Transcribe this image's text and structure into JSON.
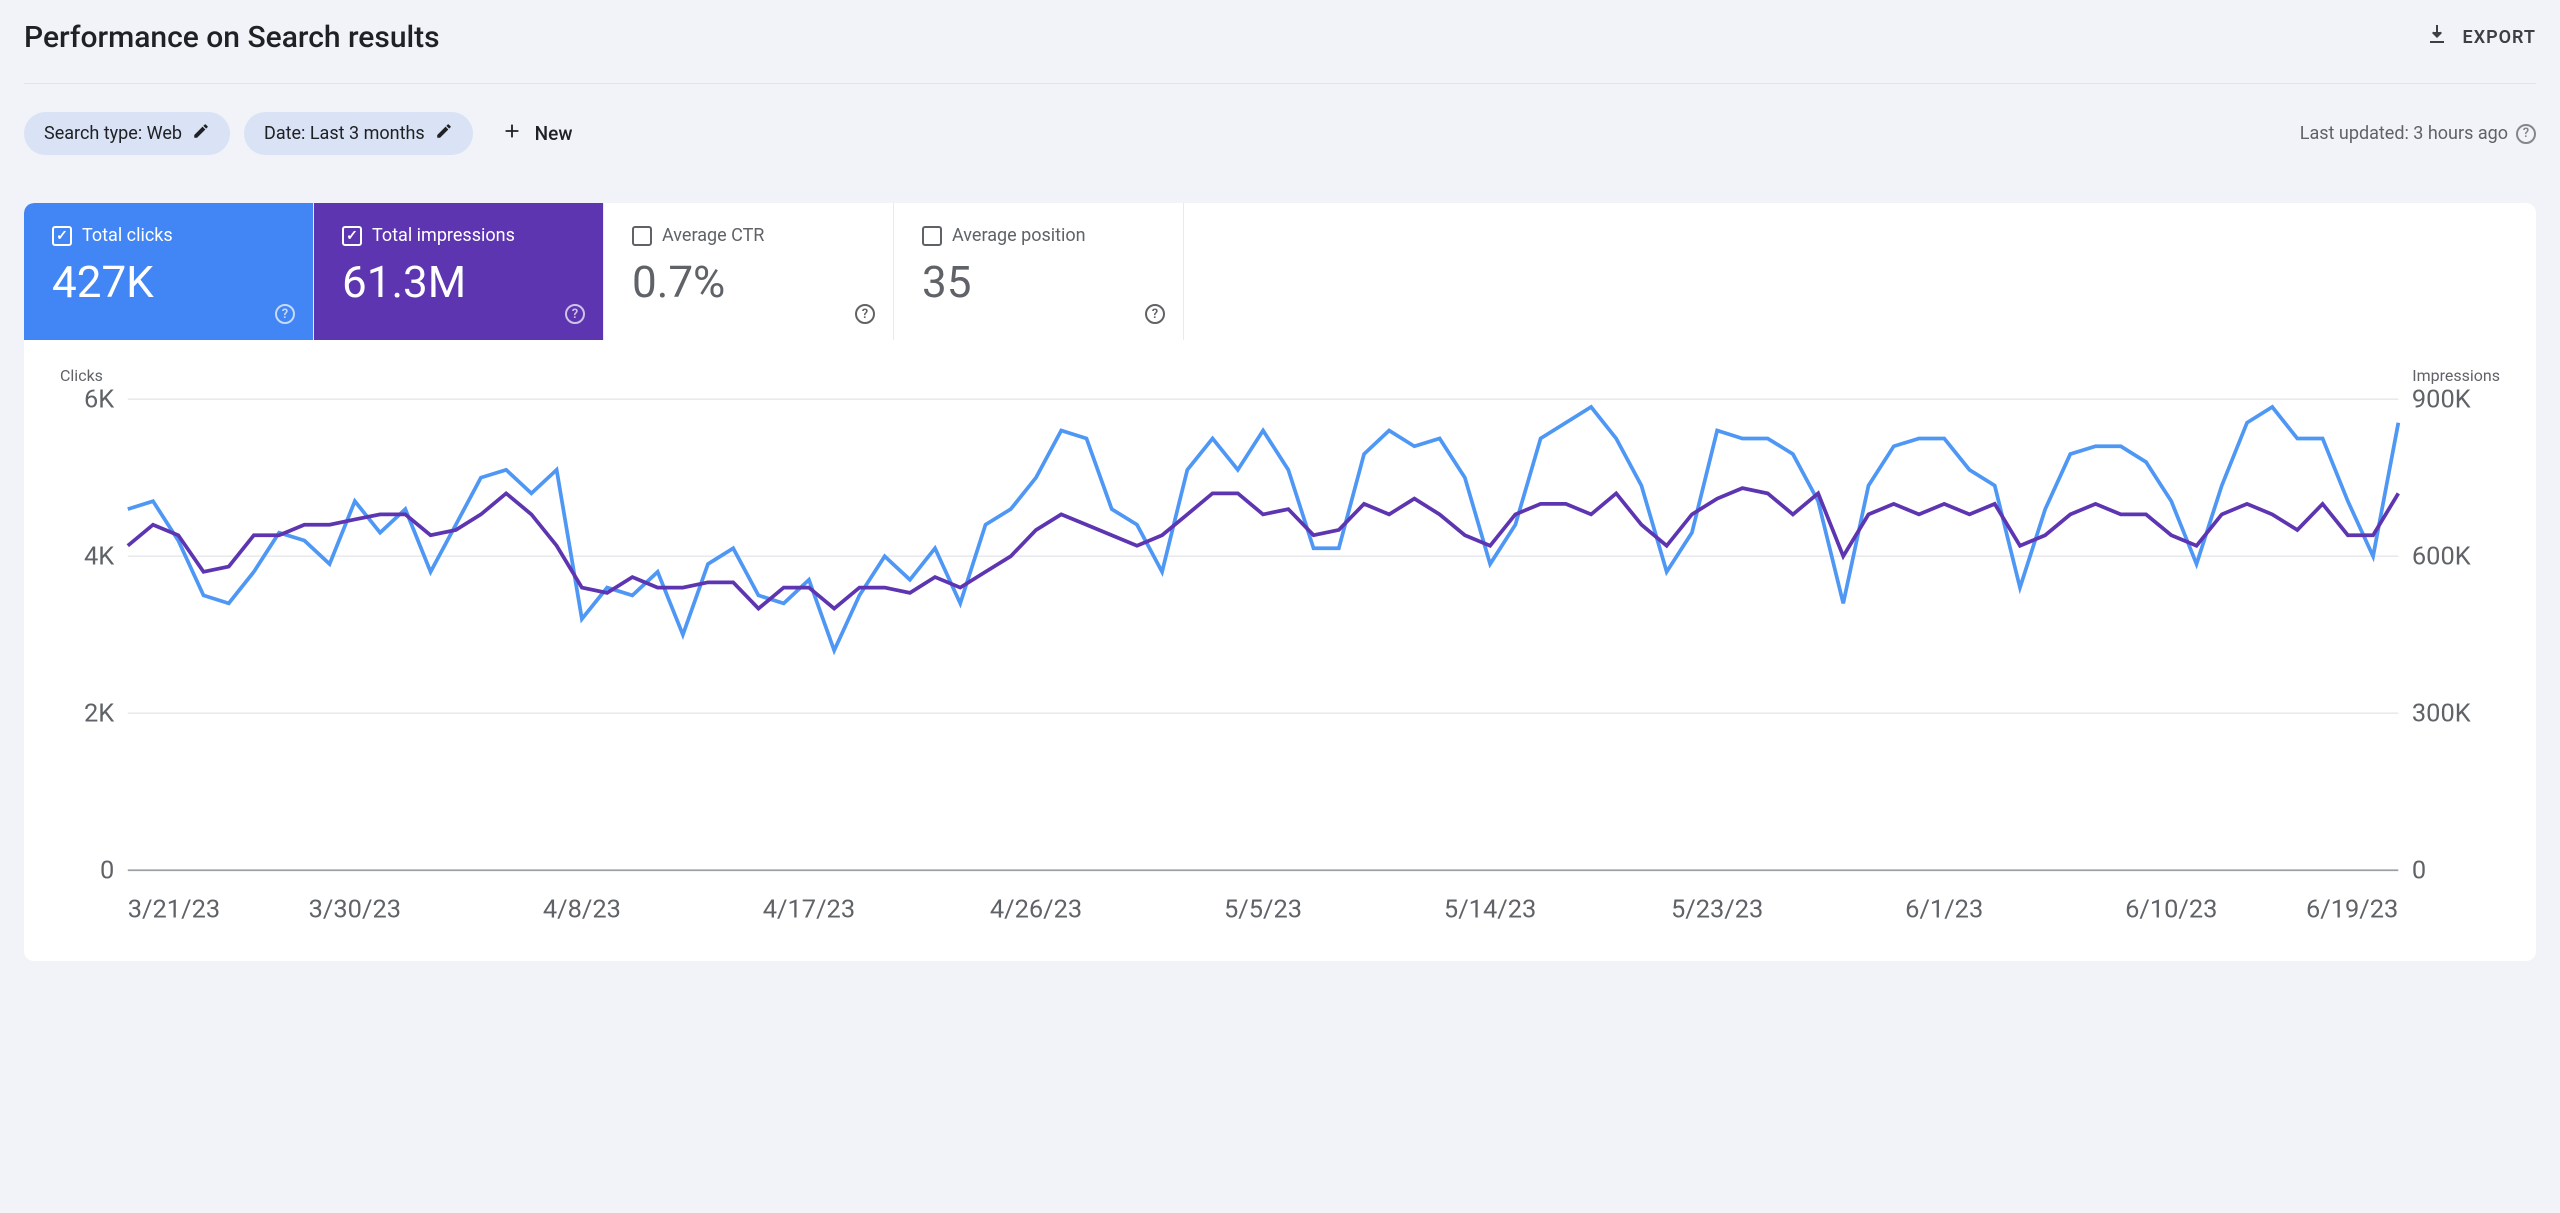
{
  "header": {
    "title": "Performance on Search results",
    "export_label": "EXPORT"
  },
  "filters": {
    "search_type_chip": "Search type: Web",
    "date_chip": "Date: Last 3 months",
    "new_label": "New",
    "last_updated": "Last updated: 3 hours ago"
  },
  "metrics": {
    "clicks": {
      "label": "Total clicks",
      "value": "427K"
    },
    "impressions": {
      "label": "Total impressions",
      "value": "61.3M"
    },
    "ctr": {
      "label": "Average CTR",
      "value": "0.7%"
    },
    "position": {
      "label": "Average position",
      "value": "35"
    }
  },
  "chart_data": {
    "type": "line",
    "left_axis_title": "Clicks",
    "right_axis_title": "Impressions",
    "left_ticks": [
      "6K",
      "4K",
      "2K",
      "0"
    ],
    "right_ticks": [
      "900K",
      "600K",
      "300K",
      "0"
    ],
    "x_tick_labels": [
      "3/21/23",
      "3/30/23",
      "4/8/23",
      "4/17/23",
      "4/26/23",
      "5/5/23",
      "5/14/23",
      "5/23/23",
      "6/1/23",
      "6/10/23",
      "6/19/23"
    ],
    "left_ylim": [
      0,
      6000
    ],
    "right_ylim": [
      0,
      900000
    ],
    "series": [
      {
        "name": "Clicks",
        "axis": "left",
        "color": "#4e97f5",
        "values": [
          4600,
          4700,
          4200,
          3500,
          3400,
          3800,
          4300,
          4200,
          3900,
          4700,
          4300,
          4600,
          3800,
          4400,
          5000,
          5100,
          4800,
          5100,
          3200,
          3600,
          3500,
          3800,
          3000,
          3900,
          4100,
          3500,
          3400,
          3700,
          2800,
          3500,
          4000,
          3700,
          4100,
          3400,
          4400,
          4600,
          5000,
          5600,
          5500,
          4600,
          4400,
          3800,
          5100,
          5500,
          5100,
          5600,
          5100,
          4100,
          4100,
          5300,
          5600,
          5400,
          5500,
          5000,
          3900,
          4400,
          5500,
          5700,
          5900,
          5500,
          4900,
          3800,
          4300,
          5600,
          5500,
          5500,
          5300,
          4700,
          3400,
          4900,
          5400,
          5500,
          5500,
          5100,
          4900,
          3600,
          4600,
          5300,
          5400,
          5400,
          5200,
          4700,
          3900,
          4900,
          5700,
          5900,
          5500,
          5500,
          4700,
          4000,
          5700
        ]
      },
      {
        "name": "Impressions",
        "axis": "right",
        "color": "#5e35b1",
        "values": [
          620000,
          660000,
          640000,
          570000,
          580000,
          640000,
          640000,
          660000,
          660000,
          670000,
          680000,
          680000,
          640000,
          650000,
          680000,
          720000,
          680000,
          620000,
          540000,
          530000,
          560000,
          540000,
          540000,
          550000,
          550000,
          500000,
          540000,
          540000,
          500000,
          540000,
          540000,
          530000,
          560000,
          540000,
          570000,
          600000,
          650000,
          680000,
          660000,
          640000,
          620000,
          640000,
          680000,
          720000,
          720000,
          680000,
          690000,
          640000,
          650000,
          700000,
          680000,
          710000,
          680000,
          640000,
          620000,
          680000,
          700000,
          700000,
          680000,
          720000,
          660000,
          620000,
          680000,
          710000,
          730000,
          720000,
          680000,
          720000,
          600000,
          680000,
          700000,
          680000,
          700000,
          680000,
          700000,
          620000,
          640000,
          680000,
          700000,
          680000,
          680000,
          640000,
          620000,
          680000,
          700000,
          680000,
          650000,
          700000,
          640000,
          640000,
          720000
        ]
      }
    ]
  }
}
